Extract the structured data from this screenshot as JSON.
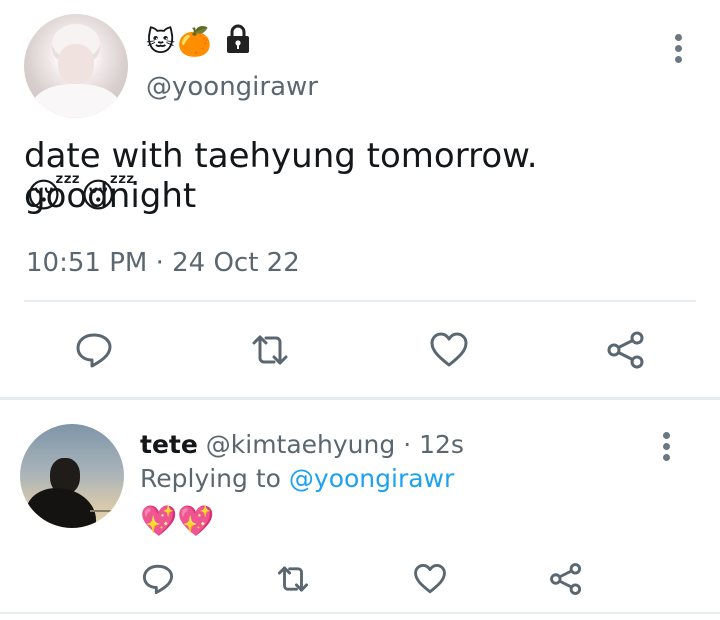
{
  "main_tweet": {
    "display_name_emojis": "🐱🍊",
    "handle": "@yoongirawr",
    "text": "date with taehyung tomorrow. goodnight",
    "emojis": "😴😴",
    "timestamp": "10:51 PM · 24 Oct 22"
  },
  "reply": {
    "name": "tete",
    "handle": "@kimtaehyung",
    "time": "· 12s",
    "replying_to_label": "Replying to",
    "replying_to_handle": "@yoongirawr",
    "emojis": "💖💖"
  },
  "icons": {
    "main": [
      "lock-icon",
      "more-icon",
      "reply-icon",
      "retweet-icon",
      "like-icon",
      "share-icon"
    ],
    "reply": [
      "more-icon",
      "reply-icon",
      "retweet-icon",
      "like-icon",
      "share-icon"
    ]
  },
  "colors": {
    "text": "#14171a",
    "secondary_text": "#5b6770",
    "icon": "#5b6770",
    "link": "#1da1f2",
    "divider": "#e6ecf0"
  }
}
